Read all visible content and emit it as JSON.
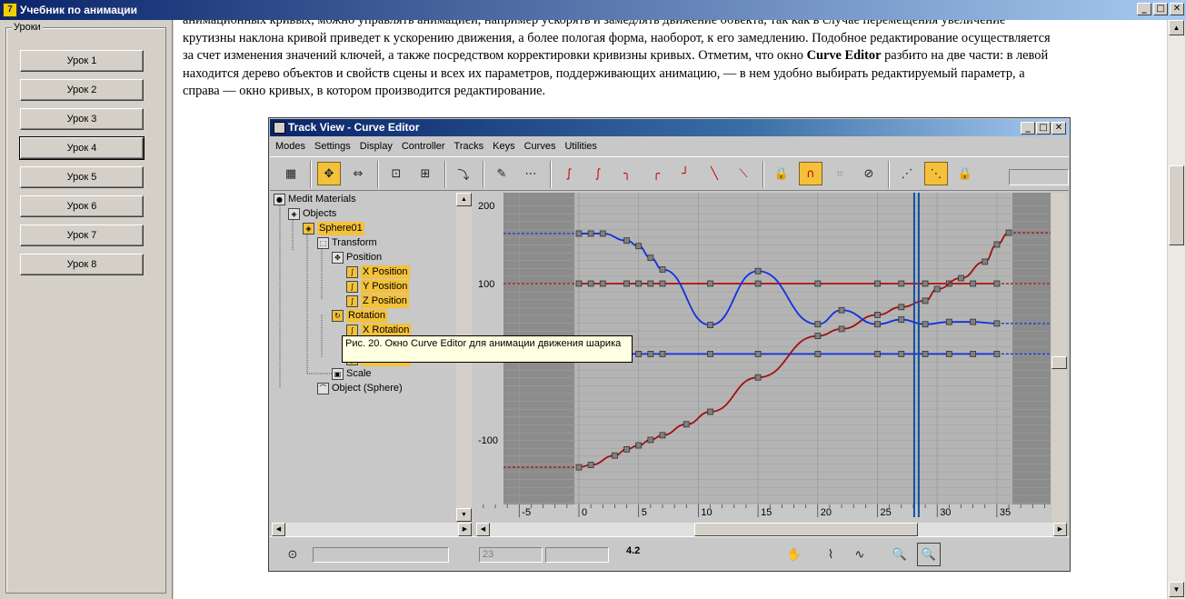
{
  "window": {
    "title": "Учебник по анимации",
    "app_icon": "7"
  },
  "sidebar": {
    "group_title": "Уроки",
    "lessons": [
      "Урок 1",
      "Урок 2",
      "Урок 3",
      "Урок 4",
      "Урок 5",
      "Урок 6",
      "Урок 7",
      "Урок 8"
    ],
    "active_index": 3
  },
  "content": {
    "line1": "анимационных кривых, можно управлять анимацией, например ускорять и замедлять движение объекта, так как в случае перемещения увеличение",
    "line2": "крутизны наклона кривой приведет к ускорению движения, а более пологая форма, наоборот, к его замедлению. Подобное редактирование осуществляется",
    "line3_pre": "за счет изменения значений ключей, а также посредством корректировки кривизны кривых. Отметим, что окно ",
    "line3_bold": "Curve Editor",
    "line3_post": " разбито на две части: в левой",
    "line4": "находится дерево объектов и свойств сцены и всех их параметров, поддерживающих анимацию, — в нем удобно выбирать редактируемый параметр, а",
    "line5": "справа — окно кривых, в котором  производится редактирование."
  },
  "figure": {
    "title": "Track View - Curve Editor",
    "menu": [
      "Modes",
      "Settings",
      "Display",
      "Controller",
      "Tracks",
      "Keys",
      "Curves",
      "Utilities"
    ],
    "tree": [
      {
        "label": "Medit Materials",
        "icon": "sphere-icon",
        "highlight": false
      },
      {
        "label": "Objects",
        "icon": "cube-icon",
        "highlight": false
      },
      {
        "label": "Sphere01",
        "icon": "cube-icon",
        "highlight": true
      },
      {
        "label": "Transform",
        "icon": "transform-icon",
        "highlight": false
      },
      {
        "label": "Position",
        "icon": "position-icon",
        "highlight": false
      },
      {
        "label": "X Position",
        "icon": "curve-icon",
        "highlight": true
      },
      {
        "label": "Y Position",
        "icon": "curve-icon",
        "highlight": true
      },
      {
        "label": "Z Position",
        "icon": "curve-icon",
        "highlight": true
      },
      {
        "label": "Rotation",
        "icon": "rotation-icon",
        "highlight": true
      },
      {
        "label": "X Rotation",
        "icon": "curve-icon",
        "highlight": true
      },
      {
        "label": "Y Rotation",
        "icon": "curve-icon",
        "highlight": true
      },
      {
        "label": "Z Rotation",
        "icon": "curve-icon",
        "highlight": true
      },
      {
        "label": "Scale",
        "icon": "scale-icon",
        "highlight": false
      },
      {
        "label": "Object (Sphere)",
        "icon": "object-icon",
        "highlight": false
      }
    ],
    "y_labels": [
      "200",
      "100",
      "-100"
    ],
    "x_labels": [
      "-5",
      "0",
      "5",
      "10",
      "15",
      "20",
      "25",
      "30",
      "35"
    ],
    "status_frame": "23",
    "status_value": "4.2",
    "tooltip": "Рис. 20. Окно Curve Editor для анимации движения шарика"
  }
}
